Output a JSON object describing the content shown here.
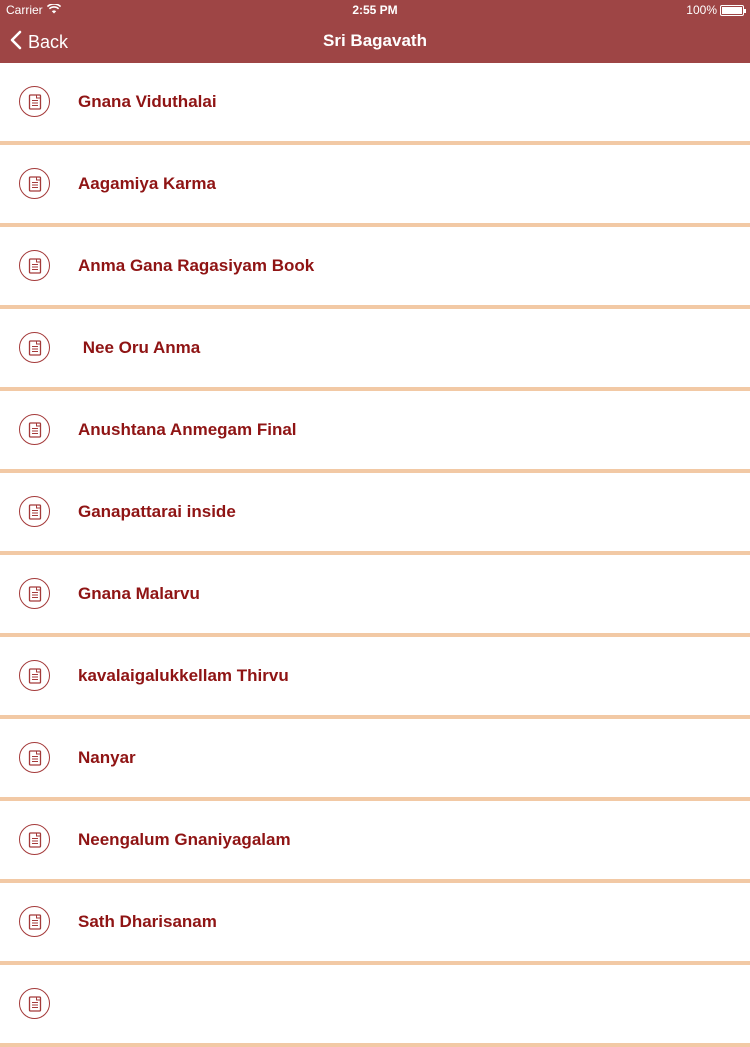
{
  "status_bar": {
    "carrier": "Carrier",
    "time": "2:55 PM",
    "battery_percent": "100%"
  },
  "nav": {
    "back_label": "Back",
    "title": "Sri Bagavath"
  },
  "colors": {
    "header_bg": "#9e4545",
    "item_text": "#8f1414",
    "separator": "#f2c9a5"
  },
  "items": [
    {
      "label": "Gnana Viduthalai"
    },
    {
      "label": "Aagamiya Karma"
    },
    {
      "label": "Anma Gana Ragasiyam Book"
    },
    {
      "label": " Nee Oru Anma"
    },
    {
      "label": "Anushtana Anmegam Final"
    },
    {
      "label": "Ganapattarai inside"
    },
    {
      "label": "Gnana Malarvu"
    },
    {
      "label": "kavalaigalukkellam Thirvu"
    },
    {
      "label": "Nanyar"
    },
    {
      "label": "Neengalum Gnaniyagalam"
    },
    {
      "label": "Sath Dharisanam"
    },
    {
      "label": ""
    }
  ]
}
